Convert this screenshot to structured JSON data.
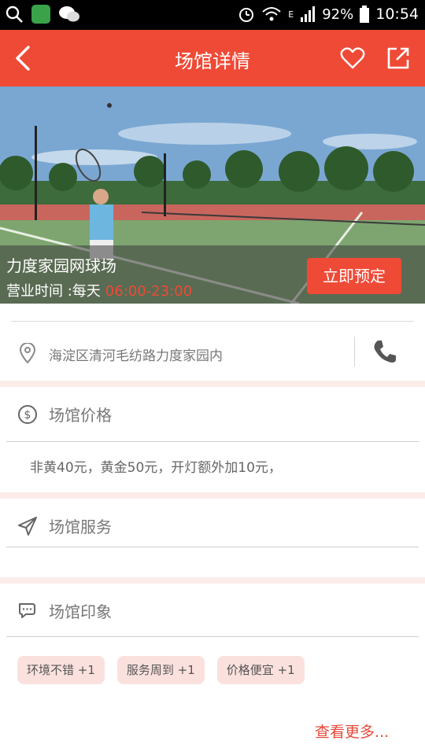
{
  "status_bar": {
    "battery": "92%",
    "time": "10:54",
    "network": "E"
  },
  "app_bar": {
    "title": "场馆详情"
  },
  "hero": {
    "venue_name": "力度家园网球场",
    "hours_label": "营业时间 :每天",
    "hours_time": "06:00-23:00",
    "book_button": "立即预定"
  },
  "address": {
    "text": "海淀区清河毛纺路力度家园内"
  },
  "price": {
    "heading": "场馆价格",
    "text": "非黄40元，黄金50元，开灯额外加10元，"
  },
  "service": {
    "heading": "场馆服务"
  },
  "impression": {
    "heading": "场馆印象",
    "tags": [
      "环境不错 +1",
      "服务周到 +1",
      "价格便宜 +1"
    ],
    "more_link": "查看更多..."
  },
  "colors": {
    "brand_red": "#ef4a36",
    "tag_bg": "#fbe1de",
    "band": "#fbecea"
  }
}
